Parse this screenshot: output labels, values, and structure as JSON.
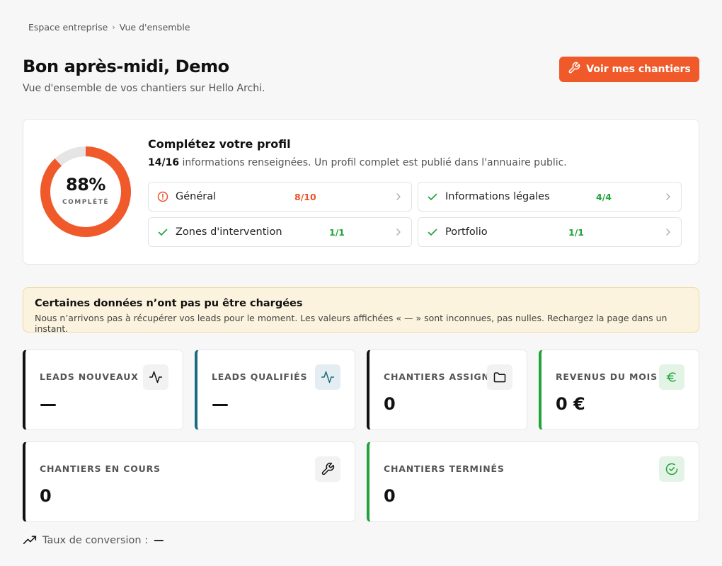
{
  "breadcrumb": {
    "root": "Espace entreprise",
    "separator": "›",
    "current": "Vue d'ensemble"
  },
  "header": {
    "title": "Bon après-midi, Demo",
    "subtitle": "Vue d'ensemble de vos chantiers sur Hello Archi.",
    "cta_label": "Voir mes chantiers"
  },
  "profile": {
    "percent_label": "88%",
    "percent_value": 88,
    "status_label": "COMPLÉTÉ",
    "title": "Complétez votre profil",
    "count": "14/16",
    "description": "informations renseignées. Un profil complet est publié dans l'annuaire public.",
    "items": [
      {
        "label": "Général",
        "count": "8/10",
        "status": "incomplete"
      },
      {
        "label": "Informations légales",
        "count": "4/4",
        "status": "complete"
      },
      {
        "label": "Zones d'intervention",
        "count": "1/1",
        "status": "complete"
      },
      {
        "label": "Portfolio",
        "count": "1/1",
        "status": "complete"
      }
    ]
  },
  "alert": {
    "title": "Certaines données n’ont pas pu être chargées",
    "text": "Nous n’arrivons pas à récupérer vos leads pour le moment. Les valeurs affichées « — » sont inconnues, pas nulles. Rechargez la page dans un instant."
  },
  "kpis": [
    {
      "label": "LEADS NOUVEAUX",
      "value": "—",
      "icon": "activity-icon"
    },
    {
      "label": "LEADS QUALIFIÉS",
      "value": "—",
      "icon": "activity-icon"
    },
    {
      "label": "CHANTIERS ASSIGNÉS",
      "value": "0",
      "icon": "folder-icon"
    },
    {
      "label": "REVENUS DU MOIS",
      "value": "0 €",
      "icon": "euro-icon"
    },
    {
      "label": "CHANTIERS EN COURS",
      "value": "0",
      "icon": "wrench-icon"
    },
    {
      "label": "CHANTIERS TERMINÉS",
      "value": "0",
      "icon": "check-circle-icon"
    }
  ],
  "conversion": {
    "label": "Taux de conversion :",
    "value": "—"
  },
  "colors": {
    "accent": "#f05a2a",
    "ring_track": "#e5e5e5",
    "success": "#22a33a",
    "alert_bg": "#fbf3de",
    "kpi_dark": "#111111",
    "kpi_teal": "#1c6a80"
  }
}
